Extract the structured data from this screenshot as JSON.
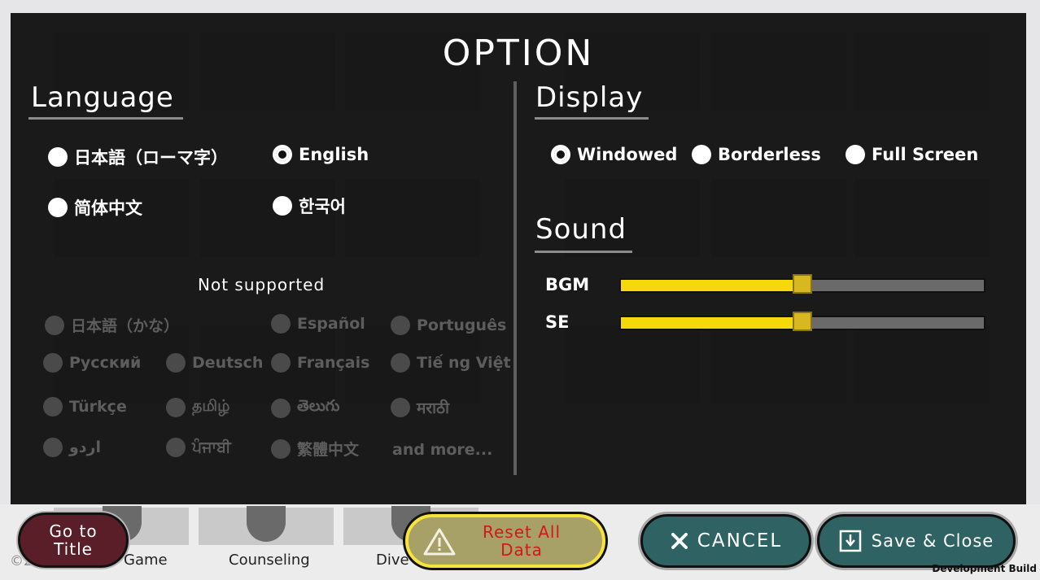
{
  "modal": {
    "title": "OPTION"
  },
  "language": {
    "heading": "Language",
    "supported": [
      {
        "label": "日本語（ローマ字）",
        "selected": false
      },
      {
        "label": "English",
        "selected": true
      },
      {
        "label": "简体中文",
        "selected": false
      },
      {
        "label": "한국어",
        "selected": false
      }
    ],
    "not_supported_label": "Not supported",
    "unsupported": [
      "日本語（かな）",
      "Español",
      "Português",
      "Русский",
      "Deutsch",
      "Français",
      "Tiế ng Việt",
      "Türkçe",
      "தமிழ்",
      "తెలుగు",
      "मराठी",
      "اردو",
      "ਪੰਜਾਬੀ",
      "繁體中文"
    ],
    "more_label": "and more..."
  },
  "display": {
    "heading": "Display",
    "options": [
      {
        "label": "Windowed",
        "selected": true
      },
      {
        "label": "Borderless",
        "selected": false
      },
      {
        "label": "Full Screen",
        "selected": false
      }
    ]
  },
  "sound": {
    "heading": "Sound",
    "bgm": {
      "label": "BGM",
      "level": 0.5
    },
    "se": {
      "label": "SE",
      "level": 0.5
    }
  },
  "buttons": {
    "go_to_title_line1": "Go to",
    "go_to_title_line2": "Title",
    "reset_line1": "Reset All",
    "reset_line2": "Data",
    "cancel": "CANCEL",
    "save_close": "Save & Close"
  },
  "background": {
    "strip_labels": [
      "Game",
      "Counseling",
      "Dive"
    ],
    "version": "©2",
    "dev_build": "Development Build"
  },
  "colors": {
    "slider_fill": "#f5d90a",
    "teal_button": "#2f6262",
    "title_button": "#5a1e28",
    "reset_text": "#d21818"
  }
}
